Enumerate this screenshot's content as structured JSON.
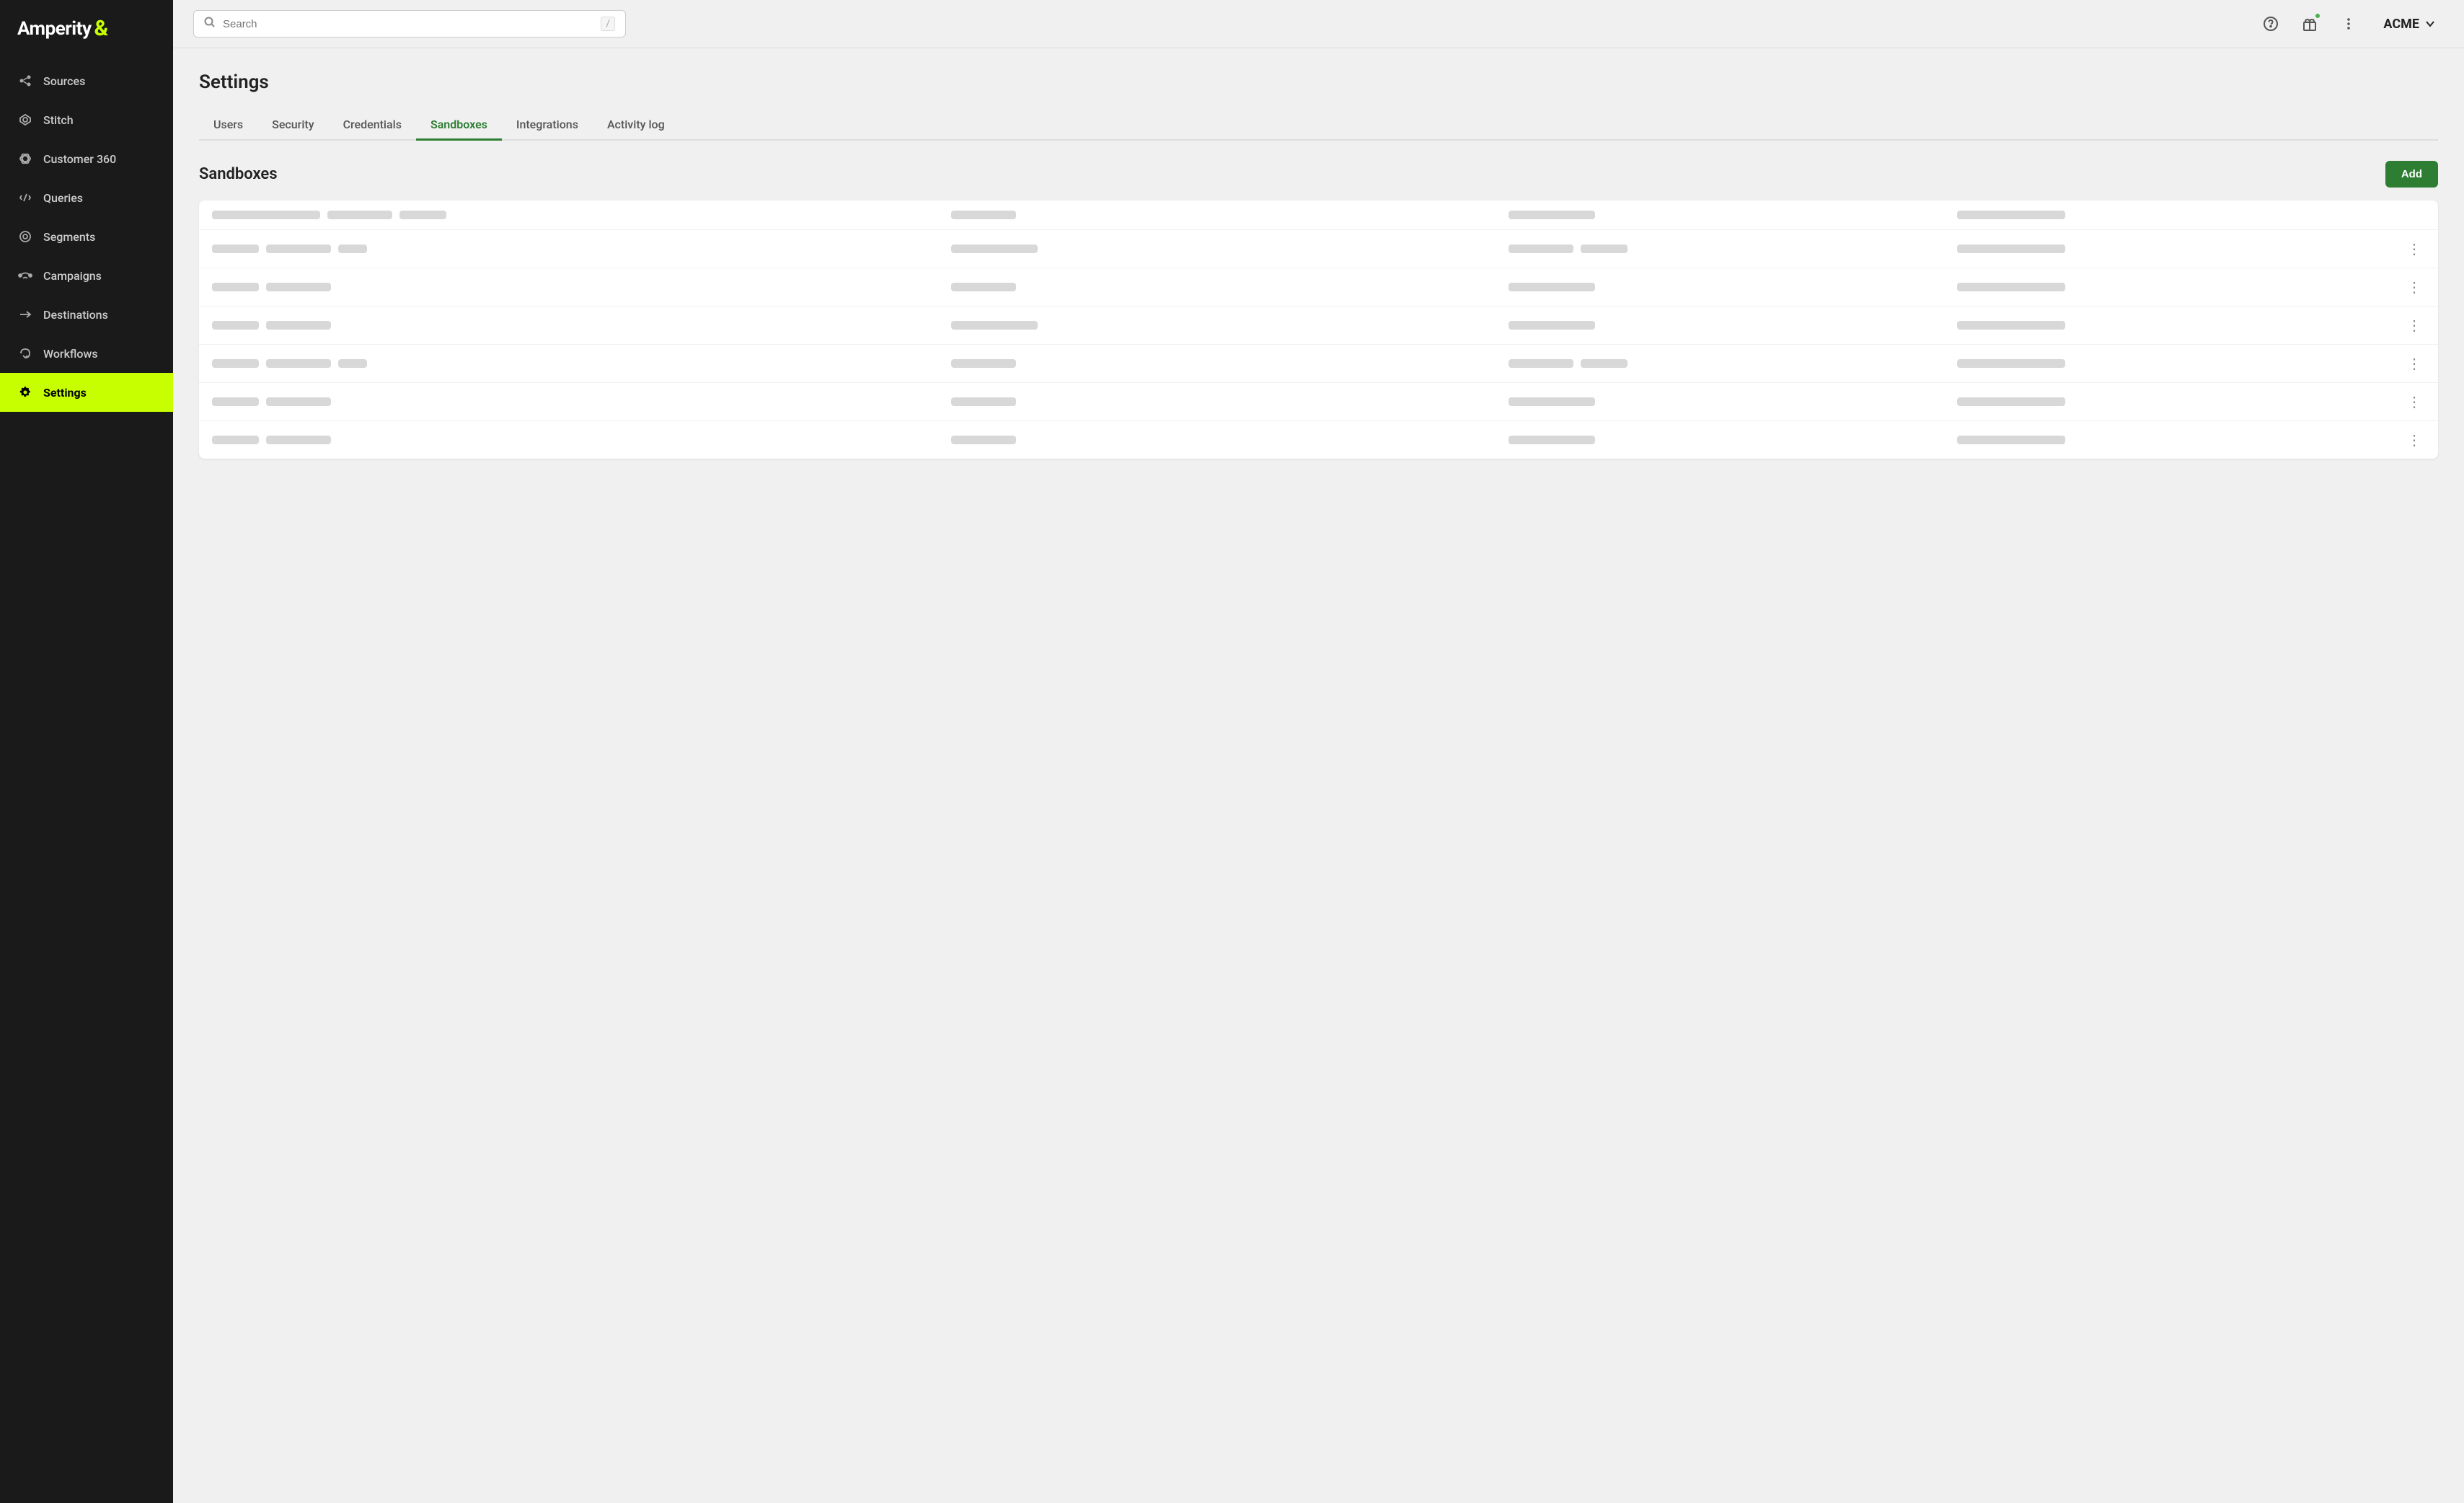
{
  "sidebar": {
    "logo": "Amperity",
    "logo_symbol": "&",
    "items": [
      {
        "id": "sources",
        "label": "Sources",
        "icon": "⊹"
      },
      {
        "id": "stitch",
        "label": "Stitch",
        "icon": "✱"
      },
      {
        "id": "customer360",
        "label": "Customer 360",
        "icon": "◎"
      },
      {
        "id": "queries",
        "label": "Queries",
        "icon": "⟨/⟩"
      },
      {
        "id": "segments",
        "label": "Segments",
        "icon": "⊙"
      },
      {
        "id": "campaigns",
        "label": "Campaigns",
        "icon": "◎"
      },
      {
        "id": "destinations",
        "label": "Destinations",
        "icon": "→"
      },
      {
        "id": "workflows",
        "label": "Workflows",
        "icon": "⟲"
      },
      {
        "id": "settings",
        "label": "Settings",
        "icon": "⚙"
      }
    ]
  },
  "topbar": {
    "search_placeholder": "Search",
    "search_shortcut": "/",
    "account_name": "ACME"
  },
  "page": {
    "title": "Settings",
    "tabs": [
      {
        "id": "users",
        "label": "Users"
      },
      {
        "id": "security",
        "label": "Security"
      },
      {
        "id": "credentials",
        "label": "Credentials"
      },
      {
        "id": "sandboxes",
        "label": "Sandboxes"
      },
      {
        "id": "integrations",
        "label": "Integrations"
      },
      {
        "id": "activity_log",
        "label": "Activity log"
      }
    ],
    "active_tab": "sandboxes"
  },
  "sandboxes": {
    "title": "Sandboxes",
    "add_button": "Add",
    "rows": [
      {
        "id": 1,
        "has_action": false
      },
      {
        "id": 2,
        "has_action": true
      },
      {
        "id": 3,
        "has_action": true
      },
      {
        "id": 4,
        "has_action": true
      },
      {
        "id": 5,
        "has_action": true
      },
      {
        "id": 6,
        "has_action": true
      },
      {
        "id": 7,
        "has_action": true
      }
    ]
  }
}
